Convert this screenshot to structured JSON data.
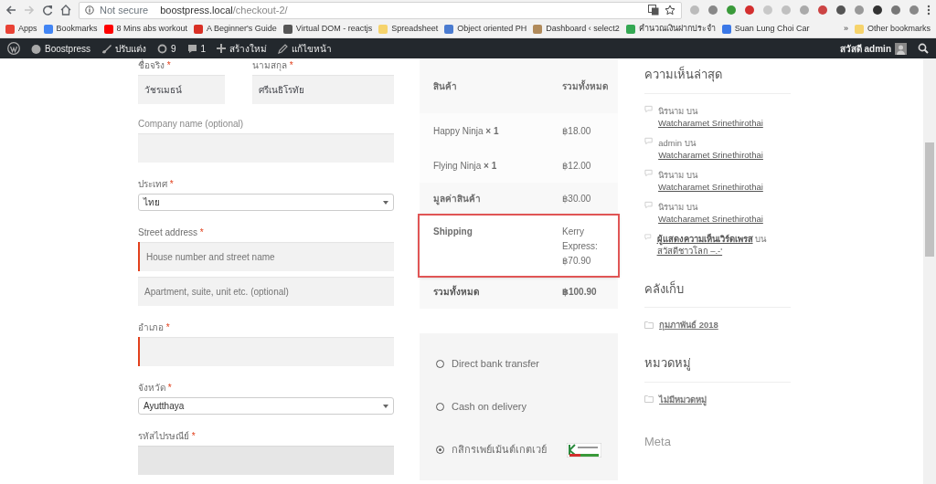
{
  "browser": {
    "back_disabled": false,
    "forward_disabled": true,
    "security": "Not secure",
    "host": "boostpress.local",
    "path": "/checkout-2/",
    "bookmarks": [
      {
        "label": "Apps",
        "color": "#e94235"
      },
      {
        "label": "Bookmarks",
        "color": "#4285f4"
      },
      {
        "label": "8 Mins abs workout",
        "color": "#ff0000"
      },
      {
        "label": "A Beginner's Guide",
        "color": "#d93025"
      },
      {
        "label": "Virtual DOM - reactjs",
        "color": "#555555"
      },
      {
        "label": "Spreadsheet",
        "color": "#f6d36b"
      },
      {
        "label": "Object oriented PH",
        "color": "#4a7bd0"
      },
      {
        "label": "Dashboard ‹ select2",
        "color": "#b08a5a"
      },
      {
        "label": "คำนวณเงินฝากประจำ",
        "color": "#34a853"
      },
      {
        "label": "Suan Lung Choi Car",
        "color": "#3b78e7"
      }
    ],
    "more": "»",
    "other": "Other bookmarks"
  },
  "admin_bar": {
    "site": "Boostpress",
    "customize": "ปรับแต่ง",
    "updates": "9",
    "comments": "1",
    "new": "สร้างใหม่",
    "edit": "แก้ไขหน้า",
    "greeting": "สวัสดี admin"
  },
  "form": {
    "rows": [
      [
        {
          "label": "ชื่อจริง",
          "required": true,
          "kind": "text",
          "value": "วัชรเมธน์",
          "invalid": false,
          "focused": false
        },
        {
          "label": "นามสกุล",
          "required": true,
          "kind": "text",
          "value": "ศรีเนธิโรทัย",
          "invalid": false,
          "focused": false
        }
      ],
      [
        {
          "label": "Company name (optional)",
          "required": false,
          "kind": "text",
          "invalid": false,
          "focused": false
        }
      ],
      [
        {
          "label": "ประเทศ",
          "required": true,
          "kind": "select",
          "value": "ไทย",
          "invalid": false,
          "focused": false
        }
      ],
      [
        {
          "label": "Street address",
          "required": true,
          "kind": "text",
          "placeholder": "House number and street name",
          "invalid": true,
          "focused": false
        }
      ],
      [
        {
          "kind": "text",
          "placeholder": "Apartment, suite, unit etc. (optional)",
          "invalid": false,
          "focused": false
        }
      ],
      [
        {
          "label": "อำเภอ",
          "required": true,
          "kind": "text",
          "invalid": true,
          "focused": false
        }
      ],
      [
        {
          "label": "จังหวัด",
          "required": true,
          "kind": "select",
          "value": "Ayutthaya",
          "invalid": false,
          "focused": false
        }
      ],
      [
        {
          "label": "รหัสไปรษณีย์",
          "required": true,
          "kind": "text",
          "invalid": false,
          "focused": true
        }
      ]
    ],
    "required_mark": "*"
  },
  "order": {
    "columns": [
      "สินค้า",
      "รวมทั้งหมด"
    ],
    "items": [
      {
        "name": "Happy Ninja",
        "qty": "× 1",
        "total": "฿18.00"
      },
      {
        "name": "Flying Ninja",
        "qty": "× 1",
        "total": "฿12.00"
      }
    ],
    "totals": [
      {
        "label": "มูลค่าสินค้า",
        "value": "฿30.00",
        "highlighted": false,
        "kind": "plain"
      },
      {
        "label": "Shipping",
        "value": "Kerry Express: ฿70.90",
        "highlighted": true,
        "kind": "plain"
      },
      {
        "label": "รวมทั้งหมด",
        "value": "฿100.90",
        "highlighted": false,
        "kind": "grand"
      }
    ]
  },
  "payments": [
    {
      "label": "Direct bank transfer",
      "selected": false,
      "logo": false
    },
    {
      "label": "Cash on delivery",
      "selected": false,
      "logo": false
    },
    {
      "label": "กสิกรเพย์เม้นต์เกตเวย์",
      "selected": true,
      "logo": true
    }
  ],
  "sidebar": {
    "recent_title": "ความเห็นล่าสุด",
    "comments": [
      {
        "author": "นิรนาม",
        "author_linked": false,
        "on": "บน",
        "post": "Watcharamet Srinethirothai"
      },
      {
        "author": "admin",
        "author_linked": false,
        "on": "บน",
        "post": "Watcharamet Srinethirothai"
      },
      {
        "author": "นิรนาม",
        "author_linked": false,
        "on": "บน",
        "post": "Watcharamet Srinethirothai"
      },
      {
        "author": "นิรนาม",
        "author_linked": false,
        "on": "บน",
        "post": "Watcharamet Srinethirothai"
      },
      {
        "author": "ผู้แสดงความเห็นเวิร์ดเพรส",
        "author_linked": true,
        "on": "บน",
        "post": "สวัสดีชาวโลก –.-'"
      }
    ],
    "archives_title": "คลังเก็บ",
    "archives": [
      "กุมภาพันธ์ 2018"
    ],
    "categories_title": "หมวดหมู่",
    "categories": [
      "ไม่มีหมวดหมู่"
    ],
    "meta_title": "Meta"
  }
}
